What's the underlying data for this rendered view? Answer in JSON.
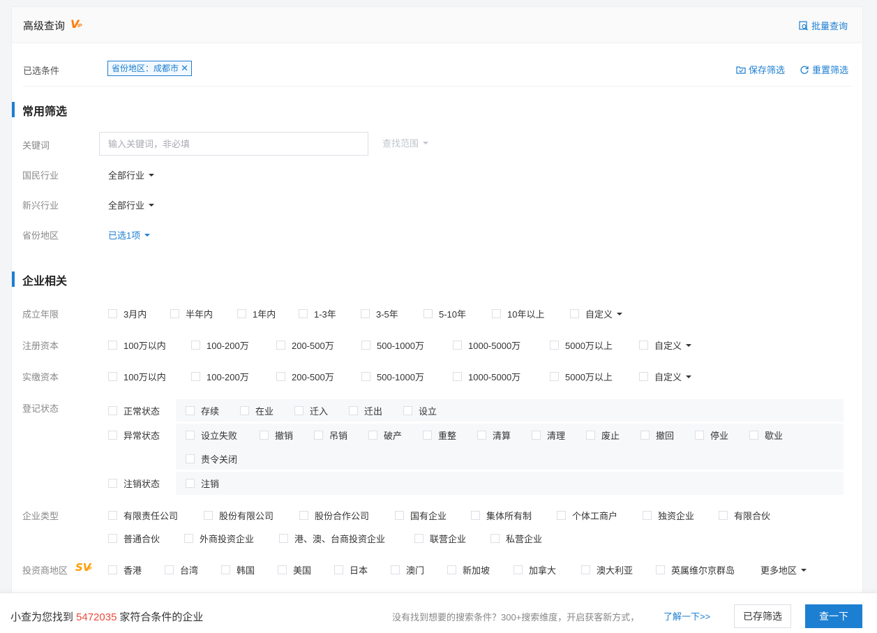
{
  "header": {
    "title": "高级查询",
    "vip_letter": "V",
    "vip_sub": "IP",
    "batch_query": "批量查询"
  },
  "selected": {
    "label": "已选条件",
    "tag": "省份地区：成都市",
    "save": "保存筛选",
    "reset": "重置筛选"
  },
  "common": {
    "title": "常用筛选",
    "keyword_label": "关键词",
    "keyword_placeholder": "输入关键词，非必填",
    "scope": "查找范围",
    "industry_label": "国民行业",
    "industry_value": "全部行业",
    "emerging_label": "新兴行业",
    "emerging_value": "全部行业",
    "region_label": "省份地区",
    "region_value": "已选1项"
  },
  "enterprise": {
    "title": "企业相关",
    "age_label": "成立年限",
    "age_options": [
      "3月内",
      "半年内",
      "1年内",
      "1-3年",
      "3-5年",
      "5-10年",
      "10年以上"
    ],
    "age_custom": "自定义",
    "reg_capital_label": "注册资本",
    "reg_capital_options": [
      "100万以内",
      "100-200万",
      "200-500万",
      "500-1000万",
      "1000-5000万",
      "5000万以上"
    ],
    "reg_capital_custom": "自定义",
    "paid_capital_label": "实缴资本",
    "paid_capital_options": [
      "100万以内",
      "100-200万",
      "200-500万",
      "500-1000万",
      "1000-5000万",
      "5000万以上"
    ],
    "paid_capital_custom": "自定义",
    "status_label": "登记状态",
    "status_normal": "正常状态",
    "status_normal_options": [
      "存续",
      "在业",
      "迁入",
      "迁出",
      "设立"
    ],
    "status_abnormal": "异常状态",
    "status_abnormal_options": [
      "设立失败",
      "撤销",
      "吊销",
      "破产",
      "重整",
      "清算",
      "清理",
      "废止",
      "撤回",
      "停业",
      "歇业",
      "责令关闭"
    ],
    "status_cancel": "注销状态",
    "status_cancel_options": [
      "注销"
    ],
    "type_label": "企业类型",
    "type_options": [
      "有限责任公司",
      "股份有限公司",
      "股份合作公司",
      "国有企业",
      "集体所有制",
      "个体工商户",
      "独资企业",
      "有限合伙",
      "普通合伙",
      "外商投资企业",
      "港、澳、台商投资企业",
      "联营企业",
      "私营企业"
    ],
    "investor_label": "投资商地区",
    "svip_letter": "SV",
    "svip_sub": "IP",
    "investor_options": [
      "香港",
      "台湾",
      "韩国",
      "美国",
      "日本",
      "澳门",
      "新加坡",
      "加拿大",
      "澳大利亚",
      "英属维尔京群岛"
    ],
    "investor_more": "更多地区"
  },
  "footer": {
    "found_prefix": "小查为您找到",
    "found_count": "5472035",
    "found_suffix": "家符合条件的企业",
    "hint": "没有找到想要的搜索条件？300+搜索维度，开启获客新方式，",
    "learn_more": "了解一下>>",
    "saved_button": "已存筛选",
    "query_button": "查一下"
  },
  "colors": {
    "accent": "#1d7fd1",
    "vip": "#ff7a00",
    "count": "#e84c3d"
  }
}
